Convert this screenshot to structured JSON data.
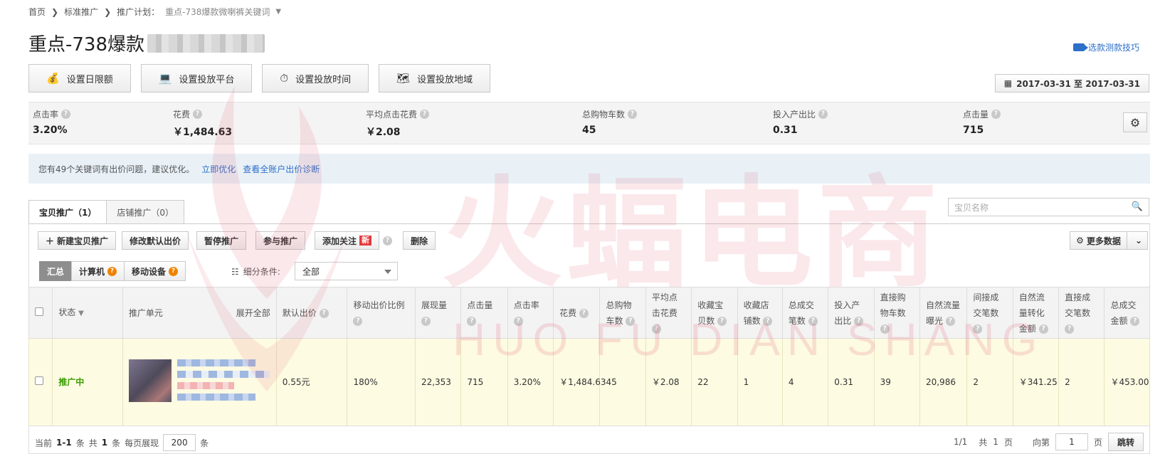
{
  "breadcrumb": {
    "home": "首页",
    "level1": "标准推广",
    "plan_label": "推广计划：",
    "plan_name": "重点-738爆款微喇裤关键词"
  },
  "title": "重点-738爆款",
  "video_tip": "选款测款技巧",
  "toolbar": [
    "设置日限额",
    "设置投放平台",
    "设置投放时间",
    "设置投放地域"
  ],
  "date_range": "2017-03-31 至 2017-03-31",
  "metrics": [
    {
      "label": "点击率",
      "value": "3.20%"
    },
    {
      "label": "花费",
      "value": "￥1,484.63"
    },
    {
      "label": "平均点击花费",
      "value": "￥2.08"
    },
    {
      "label": "总购物车数",
      "value": "45"
    },
    {
      "label": "投入产出比",
      "value": "0.31"
    },
    {
      "label": "点击量",
      "value": "715"
    }
  ],
  "notice": {
    "text": "您有49个关键词有出价问题，建议优化。",
    "link1": "立即优化",
    "link2": "查看全账户出价诊断"
  },
  "tabs": [
    "宝贝推广（1）",
    "店铺推广（0）"
  ],
  "search_placeholder": "宝贝名称",
  "actions": {
    "new": "新建宝贝推广",
    "modify": "修改默认出价",
    "pause": "暂停推广",
    "join": "参与推广",
    "follow": "添加关注",
    "new_badge": "新",
    "delete": "删除",
    "more": "更多数据"
  },
  "filters": {
    "summary": "汇总",
    "computer": "计算机",
    "mobile": "移动设备",
    "label": "细分条件:",
    "selected": "全部"
  },
  "table": {
    "headers": {
      "status": "状态",
      "unit": "推广单元",
      "expand": "展开全部",
      "bid": "默认出价",
      "mobile_ratio": "移动出价比例",
      "impressions": "展现量",
      "clicks": "点击量",
      "ctr": "点击率",
      "cost": "花费",
      "cart": "总购物车数",
      "cpc": "平均点击花费",
      "fav_item": "收藏宝贝数",
      "fav_shop": "收藏店铺数",
      "orders": "总成交笔数",
      "roi": "投入产出比",
      "direct_cart": "直接购物车数",
      "natural_exposure": "自然流量曝光",
      "indirect_orders": "间接成交笔数",
      "natural_amount": "自然流量转化金额",
      "direct_orders": "直接成交笔数",
      "total_amount": "总成交金额"
    },
    "row": {
      "status": "推广中",
      "bid": "0.55元",
      "mobile_ratio": "180%",
      "impressions": "22,353",
      "clicks": "715",
      "ctr": "3.20%",
      "cost": "￥1,484.63",
      "cart": "45",
      "cpc": "￥2.08",
      "fav_item": "22",
      "fav_shop": "1",
      "orders": "4",
      "roi": "0.31",
      "direct_cart": "39",
      "natural_exposure": "20,986",
      "indirect_orders": "2",
      "natural_amount": "￥341.25",
      "direct_orders": "2",
      "total_amount": "￥453.00"
    }
  },
  "footer": {
    "current": "当前",
    "range": "1-1",
    "tiao": "条",
    "total_prefix": "共",
    "total": "1",
    "per_page_label": "每页展现",
    "per_page": "200",
    "pages": "1/1",
    "total_pages_prefix": "共",
    "total_pages": "1",
    "ye": "页",
    "goto": "向第",
    "goto_page": "1",
    "go": "跳转"
  },
  "watermark": {
    "cn": "火蝠电商",
    "en": "HUO FU DIAN SHANG"
  }
}
